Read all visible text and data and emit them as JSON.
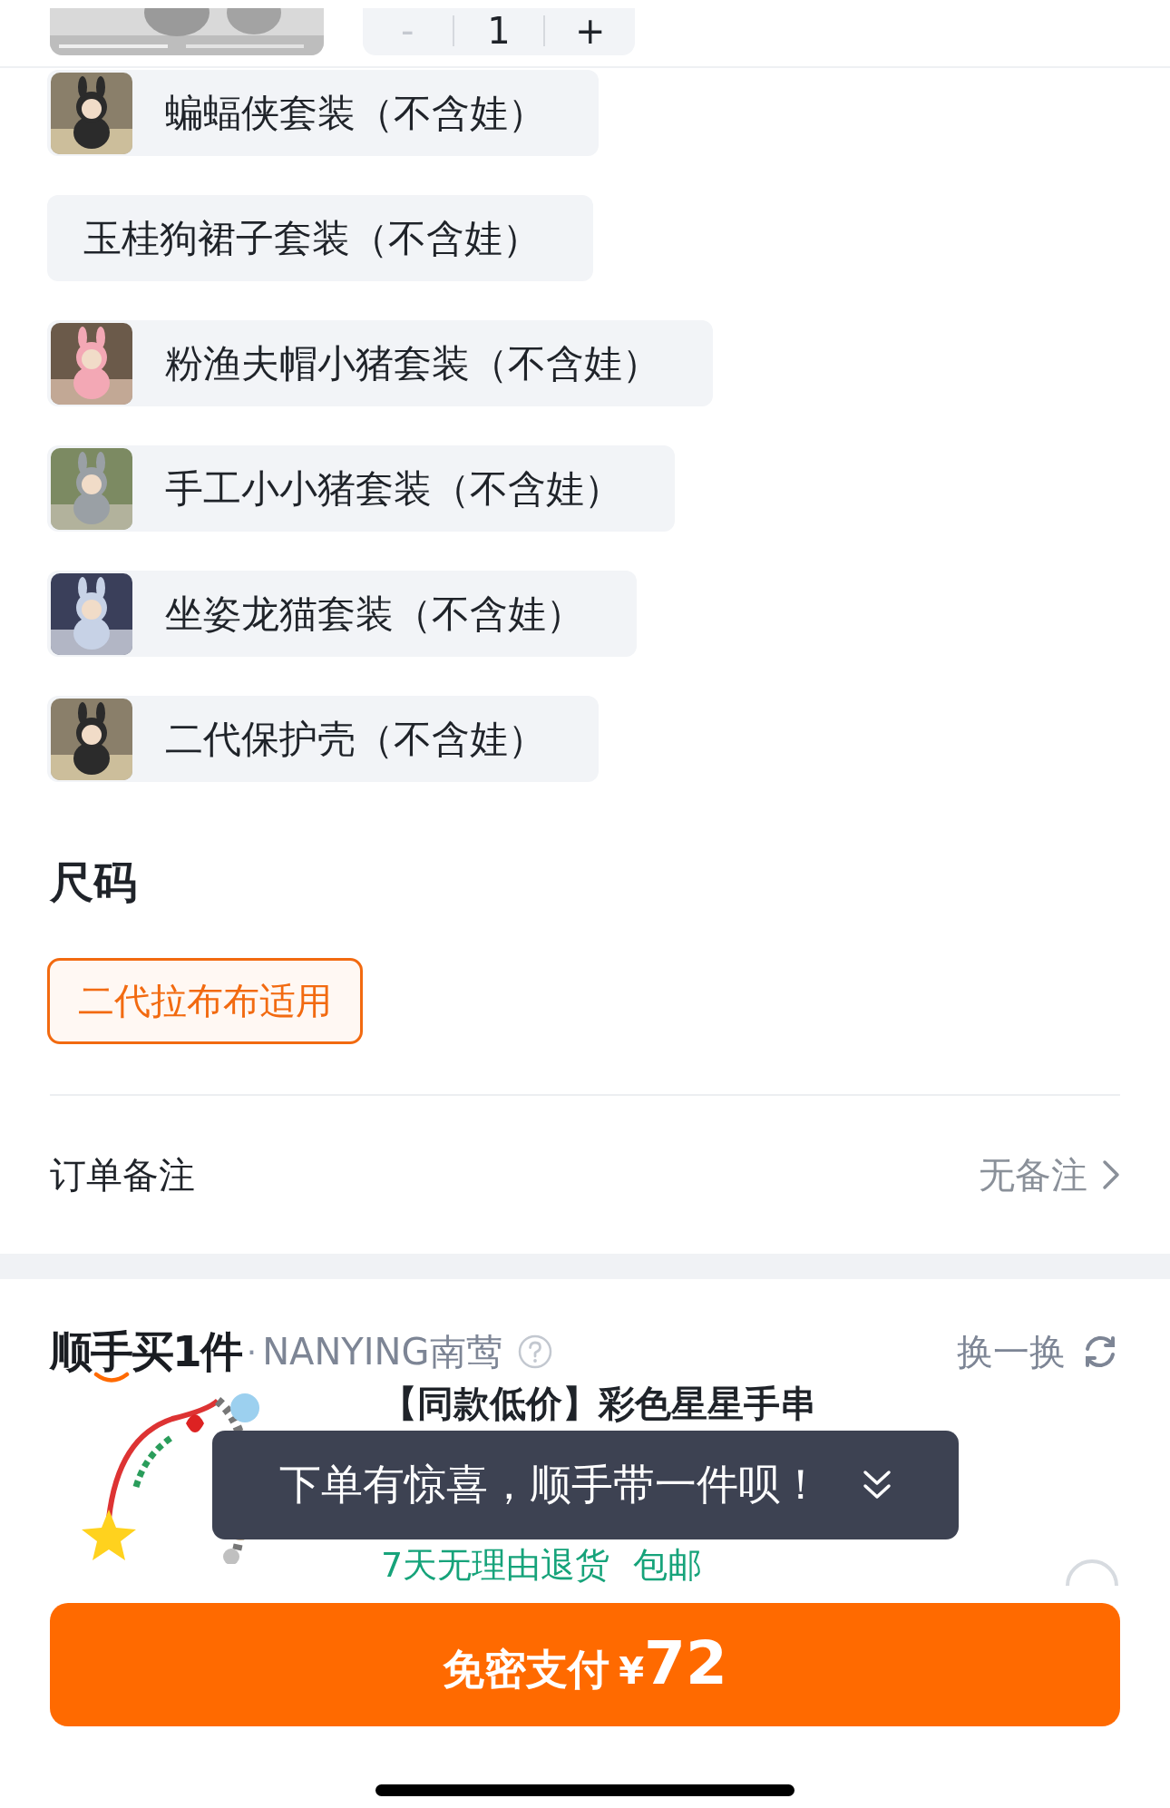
{
  "top_item": {
    "kind": "picture",
    "minus": "-",
    "minus_disabled": true,
    "quantity": "1",
    "plus": "+"
  },
  "options": [
    {
      "label": "蝙蝠侠套装（不含娃）",
      "selected": false
    },
    {
      "label": "玉桂狗裙子套装（不含娃）",
      "kind": "text",
      "selected": false
    },
    {
      "label": "粉渔夫帽小猪套装（不含娃）",
      "selected": false
    },
    {
      "label": "手工小小猪套装（不含娃）",
      "selected": false
    },
    {
      "label": "坐姿龙猫套装（不含娃）",
      "selected": false
    },
    {
      "label": "二代保护壳（不含娃）",
      "selected": false
    }
  ],
  "size_section": {
    "title": "尺码",
    "options": [
      {
        "label": "二代拉布布适用",
        "selected": true
      }
    ]
  },
  "order_note": {
    "label": "订单备注",
    "value": "无备注"
  },
  "recommend": {
    "logo": "顺手买1件",
    "separator": "·",
    "shop": "NANYING南莺",
    "action": "换一换",
    "product": {
      "kind": "picture",
      "title": "【同款低价】彩色星星手串",
      "tags": [
        "7天无理由退货",
        "包邮"
      ]
    }
  },
  "tooltip": {
    "text": "下单有惊喜，顺手带一件呗！"
  },
  "pay_button": {
    "label": "免密支付",
    "currency": "¥",
    "amount": "72"
  }
}
